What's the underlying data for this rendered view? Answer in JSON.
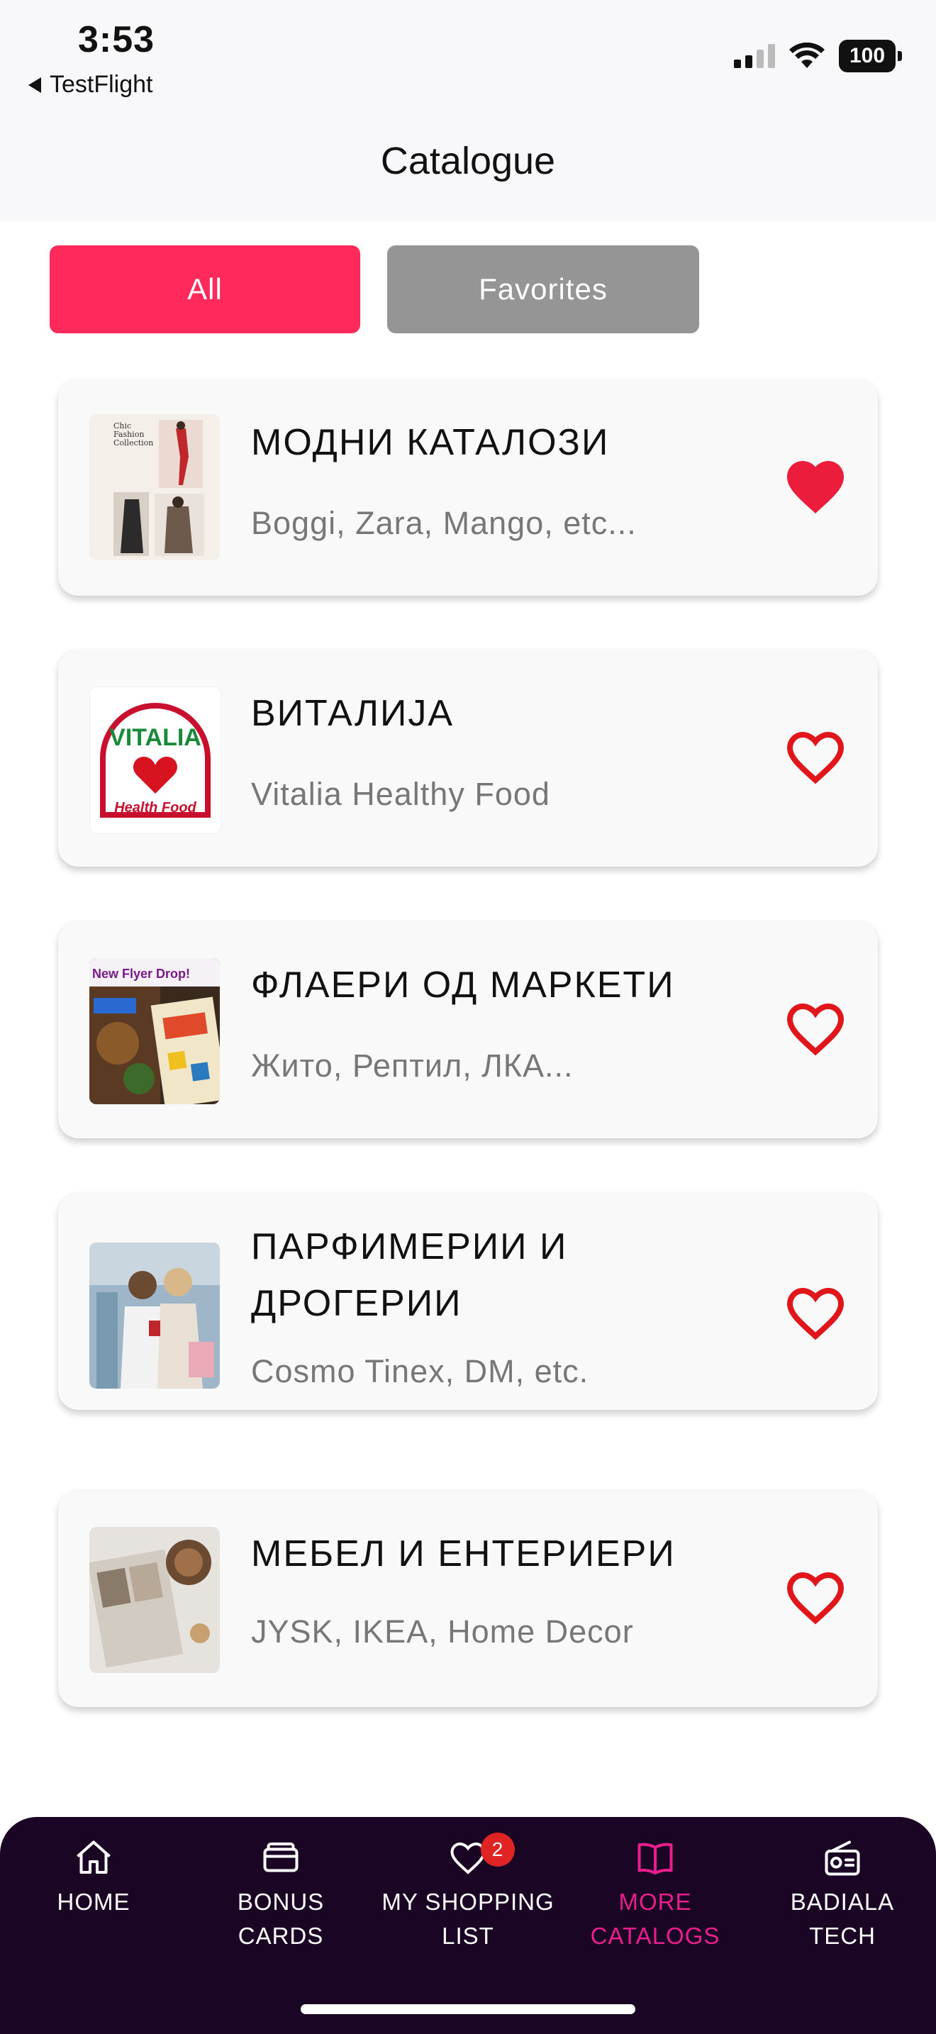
{
  "status_bar": {
    "time": "3:53",
    "back_app": "TestFlight",
    "battery": "100"
  },
  "header": {
    "title": "Catalogue"
  },
  "segments": {
    "all": "All",
    "favorites": "Favorites",
    "selected": "All",
    "selected_color": "#ff2a5b"
  },
  "catalogs": [
    {
      "title": "МОДНИ КАТАЛОЗИ",
      "subtitle": "Boggi, Zara, Mango, etc...",
      "favorite": true,
      "thumb": "fashion-collection"
    },
    {
      "title": "ВИТАЛИЈА",
      "subtitle": "Vitalia Healthy Food",
      "favorite": false,
      "thumb": "vitalia-logo",
      "logo_text": "VITALIA",
      "logo_sub": "Health Food"
    },
    {
      "title": "ФЛАЕРИ ОД МАРКЕТИ",
      "subtitle": "Жито, Рептил, ЛКА...",
      "favorite": false,
      "thumb": "flyer-drop",
      "thumb_label": "New Flyer Drop!"
    },
    {
      "title_line1": "ПАРФИМЕРИИ И",
      "title_line2": "ДРОГЕРИИ",
      "subtitle": "Cosmo Tinex, DM, etc.",
      "favorite": false,
      "thumb": "shopping-women"
    },
    {
      "title": "МЕБЕЛ И ЕНТЕРИЕРИ",
      "subtitle": "JYSK, IKEA, Home Decor",
      "favorite": false,
      "thumb": "home-decor"
    }
  ],
  "bottom_nav": {
    "items": [
      {
        "line1": "HOME",
        "line2": "",
        "icon": "home-icon"
      },
      {
        "line1": "BONUS",
        "line2": "CARDS",
        "icon": "cards-icon"
      },
      {
        "line1": "MY SHOPPING",
        "line2": "LIST",
        "icon": "heart-icon",
        "badge": "2"
      },
      {
        "line1": "MORE",
        "line2": "CATALOGS",
        "icon": "open-book-icon",
        "active": true
      },
      {
        "line1": "BADIALA",
        "line2": "TECH",
        "icon": "radio-icon"
      }
    ],
    "active_color": "#e91e8c",
    "background": "#1b0525"
  }
}
